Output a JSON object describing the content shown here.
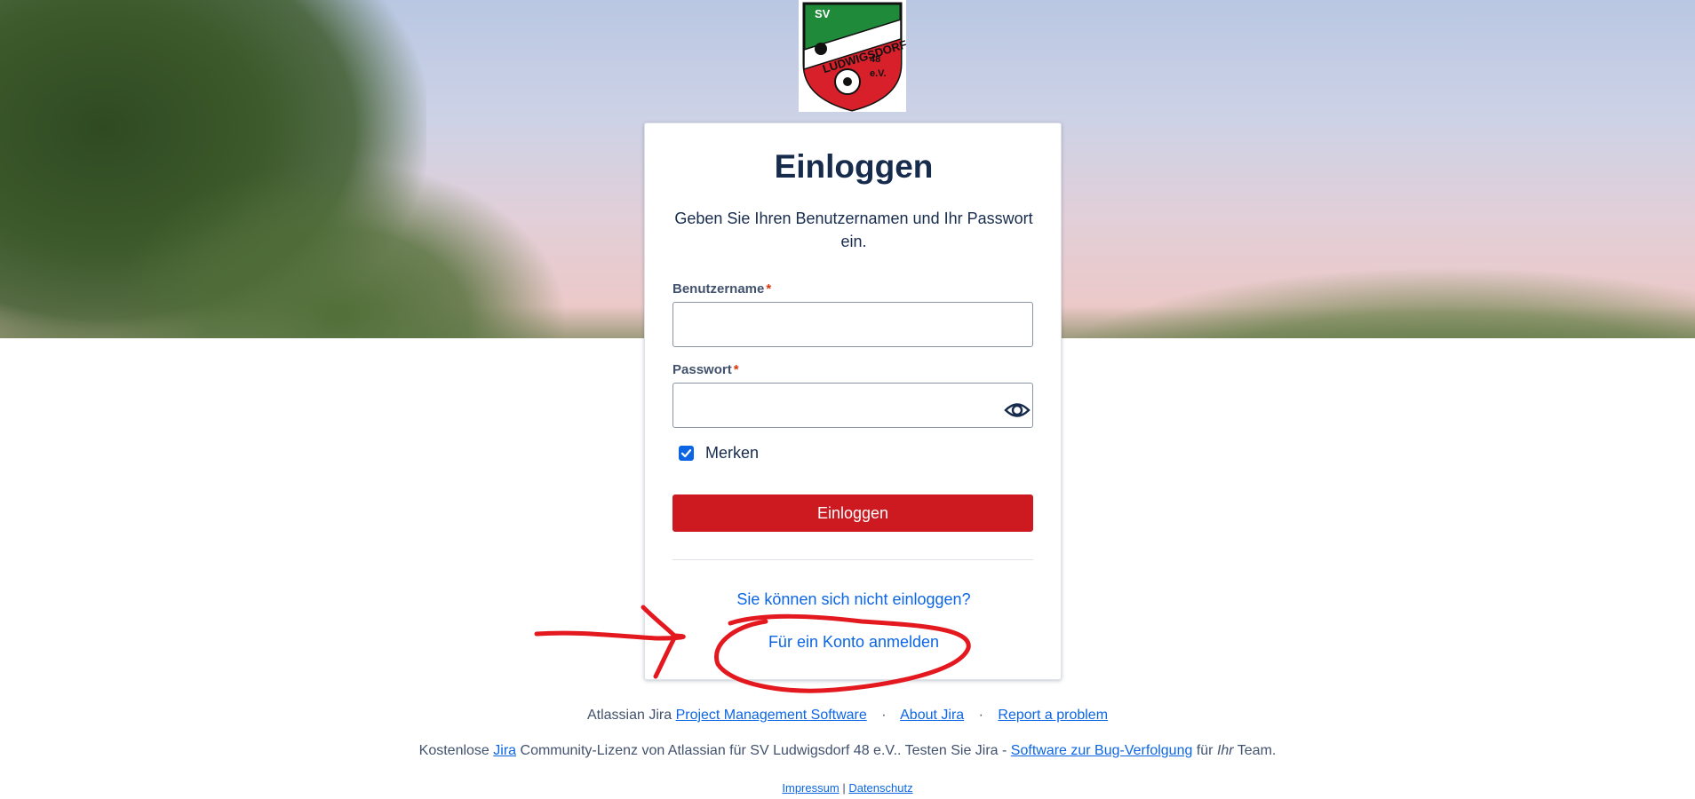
{
  "logo": {
    "text_top": "SV",
    "text_band": "LUDWIGSDORF",
    "text_num": "48",
    "text_ev": "e.V.",
    "colors": {
      "green": "#1f8a3a",
      "red": "#d8202a",
      "white": "#ffffff"
    }
  },
  "login": {
    "title": "Einloggen",
    "intro": "Geben Sie Ihren Benutzernamen und Ihr Passwort ein.",
    "username_label": "Benutzername",
    "username_value": "",
    "password_label": "Passwort",
    "password_value": "",
    "required_mark": "*",
    "remember_label": "Merken",
    "remember_checked": true,
    "submit_label": "Einloggen",
    "cant_login_link": "Sie können sich nicht einloggen?",
    "signup_link": "Für ein Konto anmelden"
  },
  "footer": {
    "line1_prefix": "Atlassian Jira",
    "line1_link1": "Project Management Software",
    "line1_link2": "About Jira",
    "line1_link3": "Report a problem",
    "separator": "·",
    "line2_prefix": "Kostenlose",
    "line2_jira": "Jira",
    "line2_mid": "Community-Lizenz von Atlassian für SV Ludwigsdorf 48 e.V.. Testen Sie Jira -",
    "line2_link": "Software zur Bug-Verfolgung",
    "line2_for": "für",
    "line2_ihr": "Ihr",
    "line2_team": "Team.",
    "impressum": "Impressum",
    "pipe": "|",
    "datenschutz": "Datenschutz"
  },
  "colors": {
    "primary_button": "#cd1a21",
    "link": "#0c66e4",
    "text": "#172b4d",
    "annotation": "#e3191f"
  },
  "icons": {
    "password_toggle": "eye-icon",
    "remember": "checkbox-checked-icon"
  }
}
